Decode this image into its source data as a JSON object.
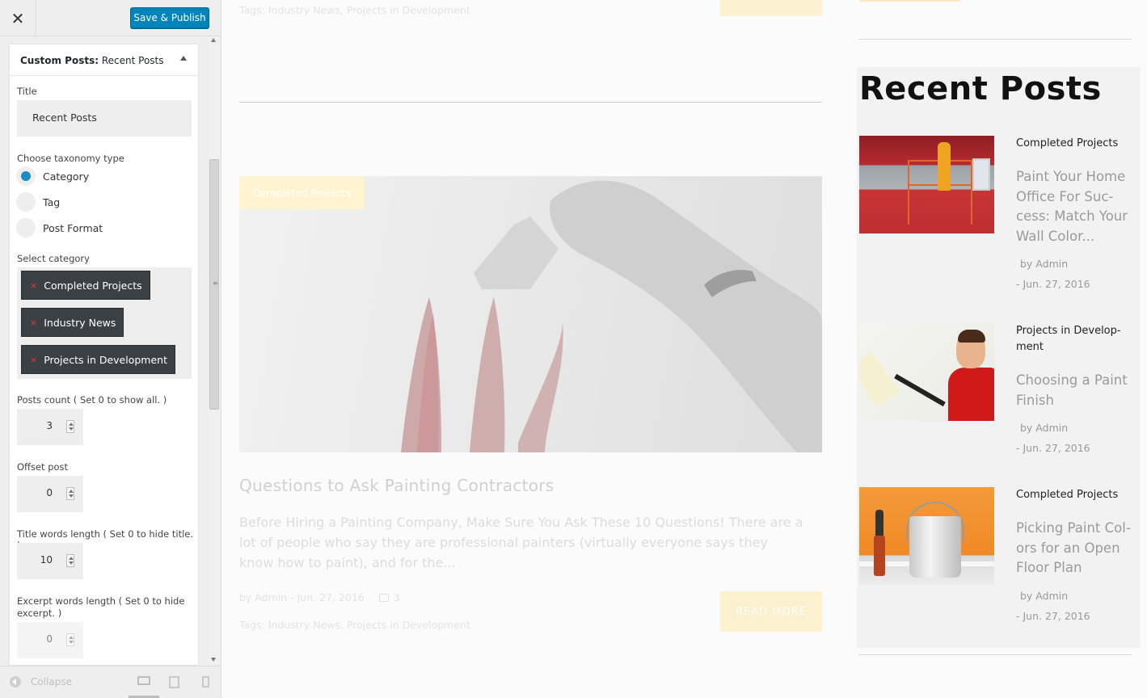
{
  "sidebar": {
    "publish_label": "Save & Publish",
    "close_glyph": "✕",
    "panel": {
      "section": "Custom Posts:",
      "name": "Recent Posts"
    },
    "title_label": "Title",
    "title_value": "Recent Posts",
    "taxonomy_label": "Choose taxonomy type",
    "taxonomy_options": [
      "Category",
      "Tag",
      "Post Format"
    ],
    "taxonomy_selected": "Category",
    "category_label": "Select category",
    "categories": [
      "Completed Projects",
      "Industry News",
      "Projects in Development"
    ],
    "chip_remove_glyph": "×",
    "posts_count_label": "Posts count ( Set 0 to show all. )",
    "posts_count_value": "3",
    "offset_label": "Offset post",
    "offset_value": "0",
    "title_words_label": "Title words length ( Set 0 to hide title. )",
    "title_words_value": "10",
    "excerpt_words_label": "Excerpt words length ( Set 0 to hide excerpt. )",
    "excerpt_words_value": "0",
    "collapse_label": "Collapse"
  },
  "preview": {
    "top_tags": "Tags: Industry News, Projects in Development",
    "featured_badge": "Completed Projects",
    "post_title": "Questions to Ask Painting Contractors",
    "post_excerpt": "Before Hiring a Painting Company, Make Sure You Ask These 10 Questions! There are a lot of people who say they are professional painters (virtually everyone says they know how to paint), and for the...",
    "post_meta": "by Admin - Jun. 27, 2016",
    "post_comments": "3",
    "post_tags": "Tags: Industry News, Projects in Development",
    "read_more": "READ MORE"
  },
  "widget": {
    "title": "Recent Posts",
    "posts": [
      {
        "category": "Completed Projects",
        "title": "Paint Your Home Office For Suc-cess: Match Your Wall Color...",
        "by": "by Admin",
        "date": "- Jun. 27, 2016"
      },
      {
        "category": "Projects in Develop-ment",
        "title": "Choosing a Paint Finish",
        "by": "by Admin",
        "date": "- Jun. 27, 2016"
      },
      {
        "category": "Completed Projects",
        "title": "Picking Paint Col-ors for an Open Floor Plan",
        "by": "by Admin",
        "date": "- Jun. 27, 2016"
      }
    ]
  },
  "colors": {
    "publish_button": "#0085ba",
    "radio_selected": "#1e8cbe",
    "chip_bg": "#3b4045",
    "chip_remove": "#e53935",
    "read_more_button": "#ffd54f"
  }
}
